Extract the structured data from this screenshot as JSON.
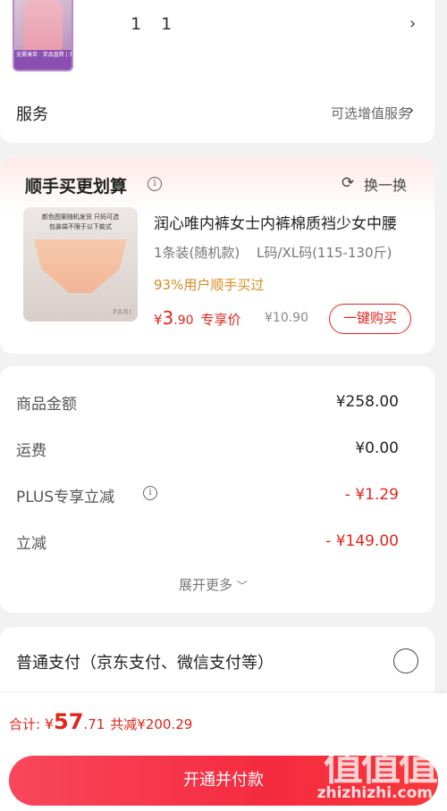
{
  "product": {
    "thumb_promo": "无需凑单 · 单品直降 | 开播官方直营",
    "quantity": "1 1"
  },
  "service": {
    "label": "服务",
    "hint": "可选增值服务"
  },
  "addon": {
    "title": "顺手买更划算",
    "refresh_label": "换一换",
    "image_banner": "颜色图案随机发货 尺码可选",
    "image_banner2": "包装袋不限于以下款式",
    "image_brand": "PARI",
    "name": "润心唯内裤女士内裤棉质裆少女中腰",
    "spec_count": "1条装(随机款)",
    "spec_size": "L码/XL码(115-130斤)",
    "popularity": "93%用户顺手买过",
    "price_yen": "¥",
    "price_int": "3",
    "price_cents": ".90",
    "price_label": "专享价",
    "original_price": "¥10.90",
    "buy_button": "一键购买"
  },
  "summary": {
    "rows": [
      {
        "label": "商品金额",
        "value": "¥258.00"
      },
      {
        "label": "运费",
        "value": "¥0.00"
      },
      {
        "label": "PLUS专享立减",
        "value": "- ¥1.29"
      },
      {
        "label": "立减",
        "value": "- ¥149.00"
      }
    ],
    "expand_label": "展开更多"
  },
  "payment": {
    "label": "普通支付（京东支付、微信支付等）"
  },
  "footer": {
    "total_label": "合计: ",
    "total_yen": "¥",
    "total_int": "57",
    "total_cents": ".71",
    "discount_text": "共减¥200.29",
    "pay_button": "开通并付款"
  },
  "watermark": {
    "glyphs": "值值值",
    "site": "zhizhizhi.com"
  },
  "colors": {
    "accent_red": "#e1251b",
    "popularity_orange": "#d98b1e",
    "pay_button": "#f52b3f"
  },
  "icons": [
    "chevron-right-icon",
    "info-icon",
    "refresh-icon",
    "chevron-down-icon",
    "radio-icon"
  ]
}
